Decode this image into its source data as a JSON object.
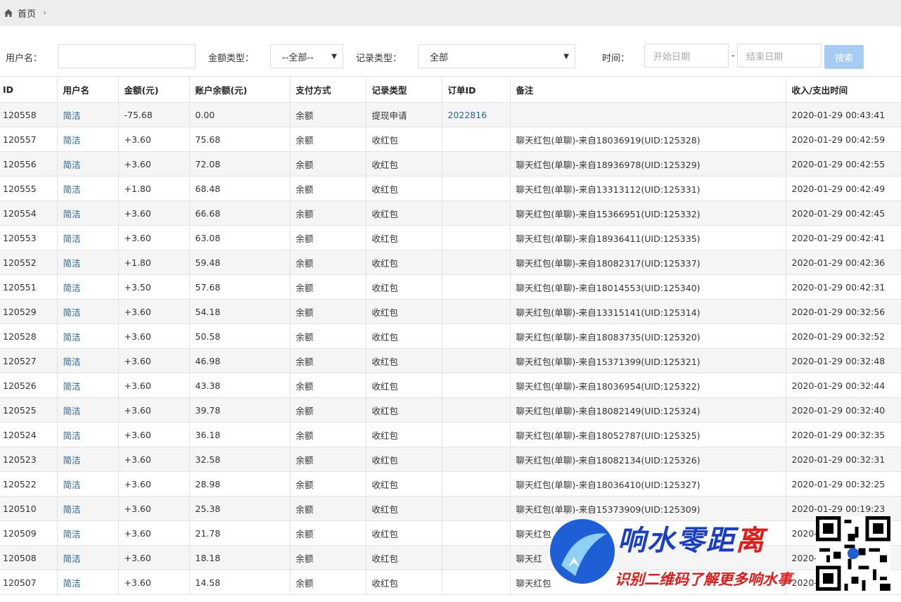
{
  "breadcrumb": {
    "home_label": "首页",
    "separator": "›"
  },
  "filters": {
    "username_label": "用户名：",
    "username_value": "",
    "amount_type_label": "金额类型：",
    "amount_type_value": "--全部--",
    "record_type_label": "记录类型：",
    "record_type_value": "全部",
    "time_label": "时间：",
    "start_date_placeholder": "开始日期",
    "range_dash": "-",
    "end_date_placeholder": "结束日期",
    "search_label": "搜索"
  },
  "table": {
    "headers": [
      "ID",
      "用户名",
      "金额(元)",
      "账户余额(元)",
      "支付方式",
      "记录类型",
      "订单ID",
      "备注",
      "收入/支出时间"
    ],
    "rows": [
      [
        "120558",
        "简洁",
        "-75.68",
        "0.00",
        "余额",
        "提现申请",
        "2022816",
        "",
        "2020-01-29 00:43:41"
      ],
      [
        "120557",
        "简洁",
        "+3.60",
        "75.68",
        "余额",
        "收红包",
        "",
        "聊天红包(单聊)-来自18036919(UID:125328)",
        "2020-01-29 00:42:59"
      ],
      [
        "120556",
        "简洁",
        "+3.60",
        "72.08",
        "余额",
        "收红包",
        "",
        "聊天红包(单聊)-来自18936978(UID:125329)",
        "2020-01-29 00:42:55"
      ],
      [
        "120555",
        "简洁",
        "+1.80",
        "68.48",
        "余额",
        "收红包",
        "",
        "聊天红包(单聊)-来自13313112(UID:125331)",
        "2020-01-29 00:42:49"
      ],
      [
        "120554",
        "简洁",
        "+3.60",
        "66.68",
        "余额",
        "收红包",
        "",
        "聊天红包(单聊)-来自15366951(UID:125332)",
        "2020-01-29 00:42:45"
      ],
      [
        "120553",
        "简洁",
        "+3.60",
        "63.08",
        "余额",
        "收红包",
        "",
        "聊天红包(单聊)-来自18936411(UID:125335)",
        "2020-01-29 00:42:41"
      ],
      [
        "120552",
        "简洁",
        "+1.80",
        "59.48",
        "余额",
        "收红包",
        "",
        "聊天红包(单聊)-来自18082317(UID:125337)",
        "2020-01-29 00:42:36"
      ],
      [
        "120551",
        "简洁",
        "+3.50",
        "57.68",
        "余额",
        "收红包",
        "",
        "聊天红包(单聊)-来自18014553(UID:125340)",
        "2020-01-29 00:42:31"
      ],
      [
        "120529",
        "简洁",
        "+3.60",
        "54.18",
        "余额",
        "收红包",
        "",
        "聊天红包(单聊)-来自13315141(UID:125314)",
        "2020-01-29 00:32:56"
      ],
      [
        "120528",
        "简洁",
        "+3.60",
        "50.58",
        "余额",
        "收红包",
        "",
        "聊天红包(单聊)-来自18083735(UID:125320)",
        "2020-01-29 00:32:52"
      ],
      [
        "120527",
        "简洁",
        "+3.60",
        "46.98",
        "余额",
        "收红包",
        "",
        "聊天红包(单聊)-来自15371399(UID:125321)",
        "2020-01-29 00:32:48"
      ],
      [
        "120526",
        "简洁",
        "+3.60",
        "43.38",
        "余额",
        "收红包",
        "",
        "聊天红包(单聊)-来自18036954(UID:125322)",
        "2020-01-29 00:32:44"
      ],
      [
        "120525",
        "简洁",
        "+3.60",
        "39.78",
        "余额",
        "收红包",
        "",
        "聊天红包(单聊)-来自18082149(UID:125324)",
        "2020-01-29 00:32:40"
      ],
      [
        "120524",
        "简洁",
        "+3.60",
        "36.18",
        "余额",
        "收红包",
        "",
        "聊天红包(单聊)-来自18052787(UID:125325)",
        "2020-01-29 00:32:35"
      ],
      [
        "120523",
        "简洁",
        "+3.60",
        "32.58",
        "余额",
        "收红包",
        "",
        "聊天红包(单聊)-来自18082134(UID:125326)",
        "2020-01-29 00:32:31"
      ],
      [
        "120522",
        "简洁",
        "+3.60",
        "28.98",
        "余额",
        "收红包",
        "",
        "聊天红包(单聊)-来自18036410(UID:125327)",
        "2020-01-29 00:32:25"
      ],
      [
        "120510",
        "简洁",
        "+3.60",
        "25.38",
        "余额",
        "收红包",
        "",
        "聊天红包(单聊)-来自15373909(UID:125309)",
        "2020-01-29 00:19:23"
      ],
      [
        "120509",
        "简洁",
        "+3.60",
        "21.78",
        "余额",
        "收红包",
        "",
        "聊天红包",
        "2020-0"
      ],
      [
        "120508",
        "简洁",
        "+3.60",
        "18.18",
        "余额",
        "收红包",
        "",
        "聊天红",
        "2020-0"
      ],
      [
        "120507",
        "简洁",
        "+3.60",
        "14.58",
        "余额",
        "收红包",
        "",
        "聊天红包",
        "2020-0"
      ]
    ]
  },
  "watermark": {
    "title_part1": "响水零距",
    "title_part2": "离",
    "subtitle": "识别二维码了解更多响水事"
  },
  "colors": {
    "link": "#2a6496",
    "search_button": "#a5cdf4",
    "stripe": "#f5f5f5",
    "watermark_blue": "#1a3fc4",
    "watermark_red": "#e21b1b"
  },
  "icons": {
    "breadcrumb_home": "home-icon",
    "select_caret": "caret-down-icon"
  }
}
